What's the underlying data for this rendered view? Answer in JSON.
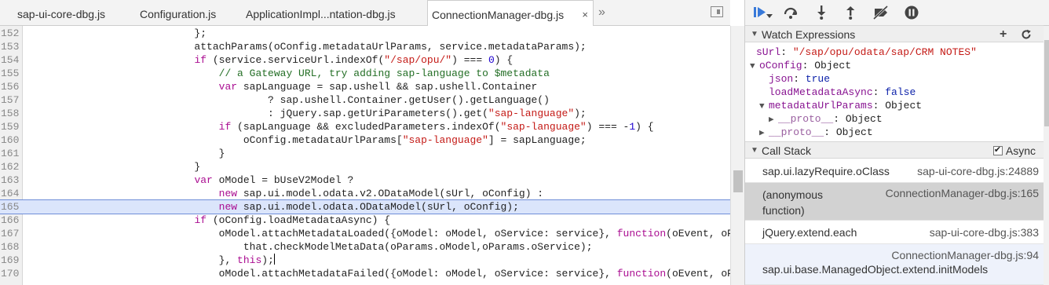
{
  "tabs": [
    {
      "label": "sap-ui-core-dbg.js",
      "active": false
    },
    {
      "label": "Configuration.js",
      "active": false
    },
    {
      "label": "ApplicationImpl...ntation-dbg.js",
      "active": false
    },
    {
      "label": "ConnectionManager-dbg.js",
      "active": true
    }
  ],
  "tab_close_glyph": "×",
  "tab_more_glyph": "»",
  "editor": {
    "highlighted_line": 165,
    "lines": [
      {
        "n": "152",
        "text": "                            };"
      },
      {
        "n": "153",
        "text": "                            attachParams(oConfig.metadataUrlParams, service.metadataParams);"
      },
      {
        "n": "154",
        "text": "                            if (service.serviceUrl.indexOf(\"/sap/opu/\") === 0) {"
      },
      {
        "n": "155",
        "text": "                                // a Gateway URL, try adding sap-language to $metadata"
      },
      {
        "n": "156",
        "text": "                                var sapLanguage = sap.ushell && sap.ushell.Container"
      },
      {
        "n": "157",
        "text": "                                        ? sap.ushell.Container.getUser().getLanguage()"
      },
      {
        "n": "158",
        "text": "                                        : jQuery.sap.getUriParameters().get(\"sap-language\");"
      },
      {
        "n": "159",
        "text": "                                if (sapLanguage && excludedParameters.indexOf(\"sap-language\") === -1) {"
      },
      {
        "n": "160",
        "text": "                                    oConfig.metadataUrlParams[\"sap-language\"] = sapLanguage;"
      },
      {
        "n": "161",
        "text": "                                }"
      },
      {
        "n": "162",
        "text": "                            }"
      },
      {
        "n": "163",
        "text": "                            var oModel = bUseV2Model ?"
      },
      {
        "n": "164",
        "text": "                                new sap.ui.model.odata.v2.ODataModel(sUrl, oConfig) :"
      },
      {
        "n": "165",
        "text": "                                new sap.ui.model.odata.ODataModel(sUrl, oConfig);"
      },
      {
        "n": "166",
        "text": "                            if (oConfig.loadMetadataAsync) {"
      },
      {
        "n": "167",
        "text": "                                oModel.attachMetadataLoaded({oModel: oModel, oService: service}, function(oEvent, oParams) {"
      },
      {
        "n": "168",
        "text": "                                    that.checkModelMetaData(oParams.oModel,oParams.oService);"
      },
      {
        "n": "169",
        "text": "                                }, this);"
      },
      {
        "n": "170",
        "text": "                                oModel.attachMetadataFailed({oModel: oModel, oService: service}, function(oEvent, oParams) {"
      }
    ]
  },
  "debugger": {
    "toolbar_buttons": [
      "resume-icon",
      "step-over-icon",
      "step-into-icon",
      "step-out-icon",
      "deactivate-breakpoints-icon",
      "pause-on-exceptions-icon"
    ],
    "watch": {
      "title": "Watch Expressions",
      "add_glyph": "+",
      "refresh_glyph": "C",
      "entries": [
        {
          "indent": 0,
          "toggle": "",
          "key": "sUrl",
          "sep": ": ",
          "value": "\"/sap/opu/odata/sap/CRM NOTES\"",
          "kind": "str"
        },
        {
          "indent": 0,
          "toggle": "▼",
          "key": "oConfig",
          "sep": ": ",
          "value": "Object",
          "kind": "plain"
        },
        {
          "indent": 1,
          "toggle": "",
          "key": "json",
          "sep": ": ",
          "value": "true",
          "kind": "kw"
        },
        {
          "indent": 1,
          "toggle": "",
          "key": "loadMetadataAsync",
          "sep": ": ",
          "value": "false",
          "kind": "kw"
        },
        {
          "indent": 1,
          "toggle": "▼",
          "key": "metadataUrlParams",
          "sep": ": ",
          "value": "Object",
          "kind": "plain"
        },
        {
          "indent": 2,
          "toggle": "▶",
          "key": "__proto__",
          "sep": ": ",
          "value": "Object",
          "kind": "plain",
          "dim": true
        },
        {
          "indent": 1,
          "toggle": "▶",
          "key": "__proto__",
          "sep": ": ",
          "value": "Object",
          "kind": "plain",
          "dim": true
        }
      ]
    },
    "callstack": {
      "title": "Call Stack",
      "async_label": "Async",
      "async_checked": true,
      "frames": [
        {
          "fn": "sap.ui.lazyRequire.oClass",
          "loc": "sap-ui-core-dbg.js:24889"
        },
        {
          "fn": "(anonymous\nfunction)",
          "loc": "ConnectionManager-dbg.js:165",
          "selected": true
        },
        {
          "fn": "jQuery.extend.each",
          "loc": "sap-ui-core-dbg.js:383"
        },
        {
          "fn": "sap.ui.base.ManagedObject.extend.initModels",
          "loc": "ConnectionManager-dbg.js:94"
        }
      ]
    }
  },
  "colors": {
    "accent": "#3879d9",
    "highlight_line": "#dbe5fb",
    "selected_frame": "#d2d2d2"
  }
}
